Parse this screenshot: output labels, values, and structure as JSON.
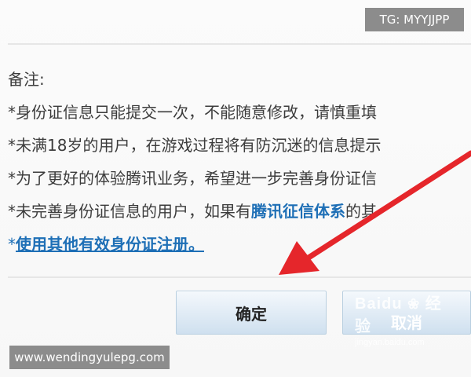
{
  "notes": {
    "heading": "备注:",
    "line1": "*身份证信息只能提交一次，不能随意修改，请慎重填",
    "line2": "*未满18岁的用户，在游戏过程将有防沉迷的信息提示",
    "line3": "*为了更好的体验腾讯业务，希望进一步完善身份证信",
    "line4_prefix": "*未完善身份证信息的用户，如果有",
    "line4_link": "腾讯征信体系",
    "line4_suffix": "的其",
    "line5_prefix": "*",
    "line5_link": "使用其他有效身份证注册。"
  },
  "buttons": {
    "ok_label": "确定",
    "cancel_label": "取消"
  },
  "watermarks": {
    "top": "TG: MYYJJPP",
    "bottom": "www.wendingyulepg.com",
    "baidu_brand": "Baidu",
    "baidu_brand_cn": "经验",
    "baidu_sub": "jingyan.baidu.com"
  },
  "colors": {
    "link": "#1e6fb6",
    "arrow": "#e5262b",
    "button_gradient_top": "#f4f8fc",
    "button_gradient_bottom": "#cfe0ef"
  },
  "icons": {
    "annotation": "red-arrow-icon",
    "baidu": "baidu-paw-icon"
  }
}
